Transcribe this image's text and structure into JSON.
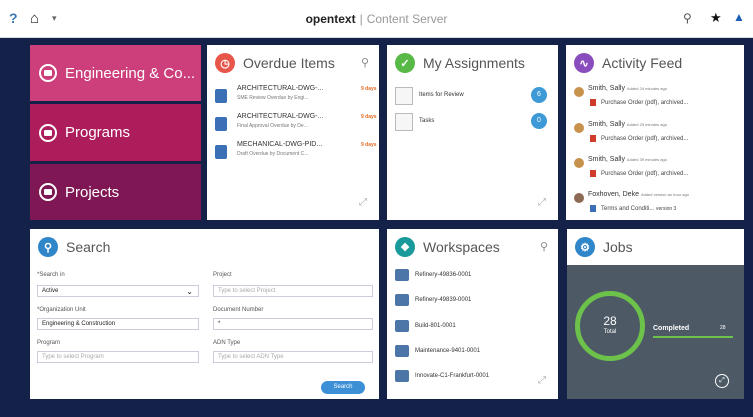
{
  "topbar": {
    "help_icon": "?",
    "home_icon": "⌂",
    "brand": "opentext",
    "separator": "|",
    "product": "Content Server"
  },
  "nav": {
    "tiles": [
      {
        "label": "Engineering & Co..."
      },
      {
        "label": "Programs"
      },
      {
        "label": "Projects"
      }
    ]
  },
  "overdue": {
    "title": "Overdue Items",
    "items": [
      {
        "name": "ARCHITECTURAL-DWG-...",
        "desc": "SME Review Overdue by Engi...",
        "due": "9 days"
      },
      {
        "name": "ARCHITECTURAL-DWG-...",
        "desc": "Final Approval Overdue by De...",
        "due": "9 days"
      },
      {
        "name": "MECHANICAL-DWG-PID...",
        "desc": "Draft Overdue by Document C...",
        "due": "9 days"
      }
    ]
  },
  "assignments": {
    "title": "My Assignments",
    "items": [
      {
        "label": "Items for Review",
        "count": "6"
      },
      {
        "label": "Tasks",
        "count": "0"
      }
    ]
  },
  "activity": {
    "title": "Activity Feed",
    "items": [
      {
        "who": "Smith, Sally",
        "when": "Added 24 minutes ago",
        "doc": "Purchase Order (pdf), archived..."
      },
      {
        "who": "Smith, Sally",
        "when": "Added 25 minutes ago",
        "doc": "Purchase Order (pdf), archived..."
      },
      {
        "who": "Smith, Sally",
        "when": "Added 39 minutes ago",
        "doc": "Purchase Order (pdf), archived..."
      },
      {
        "who": "Foxhoven, Deke",
        "when": "Added version an hour ago",
        "doc": "Terms and Conditi...",
        "extra": "version 3"
      }
    ]
  },
  "search": {
    "title": "Search",
    "search_in_label": "*Search in",
    "search_in_value": "Active",
    "org_unit_label": "*Organization Unit",
    "org_unit_value": "Engineering & Construction",
    "program_label": "Program",
    "program_placeholder": "Type to select Program",
    "project_label": "Project",
    "project_placeholder": "Type to select Project",
    "docnum_label": "Document Number",
    "docnum_value": "*",
    "adn_label": "ADN Type",
    "adn_placeholder": "Type to select ADN Type",
    "button": "Search"
  },
  "workspaces": {
    "title": "Workspaces",
    "items": [
      {
        "label": "Refinery-49836-0001"
      },
      {
        "label": "Refinery-49839-0001"
      },
      {
        "label": "Build-801-0001"
      },
      {
        "label": "Maintenance-9401-0001"
      },
      {
        "label": "Innovate-C1-Frankfurt-0001"
      }
    ]
  },
  "jobs": {
    "title": "Jobs",
    "total_count": "28",
    "total_label": "Total",
    "completed_label": "Completed",
    "completed_count": "28"
  },
  "colors": {
    "background": "#14224a",
    "nav_engineering": "#cd3f7a",
    "nav_programs": "#ad1d5c",
    "nav_projects": "#7e1754",
    "overdue_icon": "#e8564b",
    "assignments_icon": "#58b947",
    "activity_icon": "#8a4dbd",
    "search_icon": "#2f86c8",
    "workspaces_icon": "#1a9a9a",
    "jobs_icon": "#2f86c8",
    "jobs_ring": "#6cc24a",
    "jobs_panel": "#4d5a66"
  }
}
